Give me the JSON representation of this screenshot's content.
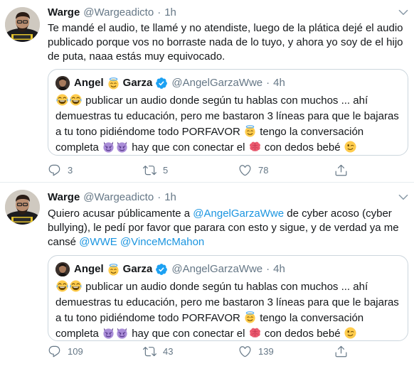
{
  "tweets": [
    {
      "name": "Warge",
      "handle": "@Wargeadicto",
      "separator": "·",
      "time": "1h",
      "text": "Te mandé el audio, te llamé y no atendiste, luego de la plática dejé el audio publicado porque vos no borraste nada de lo tuyo, y ahora yo soy de el hijo de puta, naaa estás muy equivocado.",
      "counts": {
        "reply": "3",
        "retweet": "5",
        "like": "78"
      }
    },
    {
      "name": "Warge",
      "handle": "@Wargeadicto",
      "separator": "·",
      "time": "1h",
      "text_part1": "Quiero acusar públicamente a ",
      "mention1": "@AngelGarzaWwe",
      "text_part2": " de cyber acoso (cyber bullying), le pedí por favor que parara con esto y sigue, y de verdad ya me cansé ",
      "mention2": "@WWE",
      "text_space": " ",
      "mention3": "@VinceMcMahon",
      "counts": {
        "reply": "109",
        "retweet": "43",
        "like": "139"
      }
    }
  ],
  "quoted": {
    "name_first": "Angel",
    "name_last": "Garza",
    "handle": "@AngelGarzaWwe",
    "separator": "·",
    "time": "4h",
    "text_a": " publicar un audio donde según tu hablas con muchos ... ahí demuestras tu educación, pero me bastaron 3 líneas para que le bajaras a tu tono pidiéndome todo PORFAVOR ",
    "text_b": " tengo la conversación completa ",
    "text_c": " hay que con conectar el ",
    "text_d": " con dedos bebé ",
    "emoji_icons": [
      "tears-of-joy-emoji",
      "halo-emoji",
      "devil-emoji",
      "brain-emoji",
      "wink-emoji"
    ]
  },
  "colors": {
    "link": "#1b95e0",
    "verified": "#1da1f2",
    "muted": "#657786",
    "border": "#ccd6dd"
  }
}
